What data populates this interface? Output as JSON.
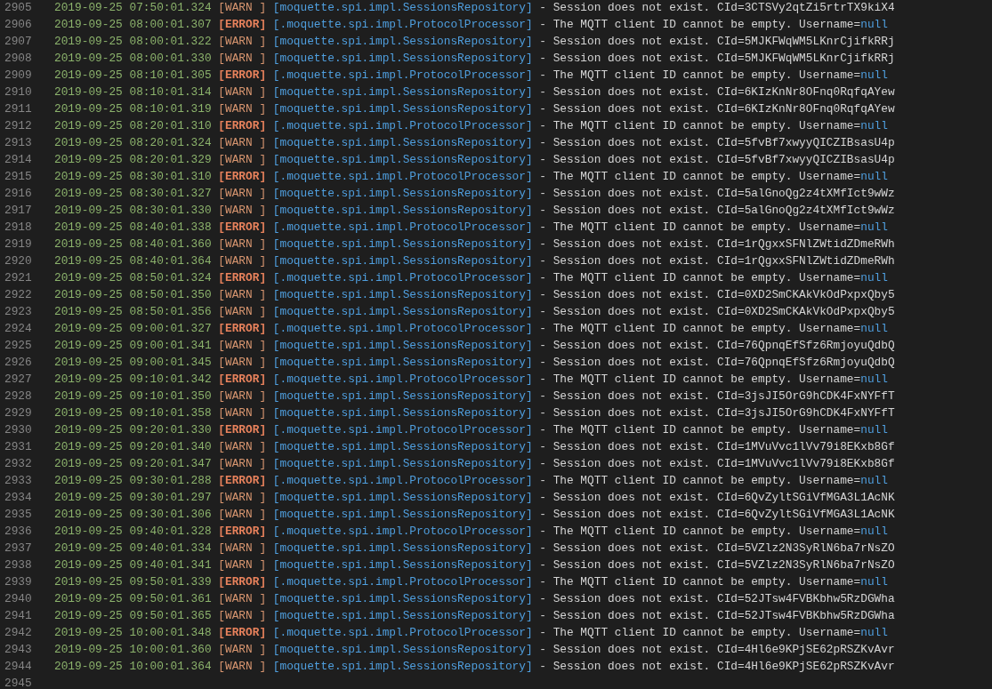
{
  "log_lines": [
    {
      "number": "2905",
      "kind": "warn",
      "timestamp": "2019-09-25 07:50:01.324",
      "level": "[WARN ]",
      "source": "[moquette.spi.impl.SessionsRepository]",
      "message": "- Session does not exist. CId=3CTSVy2qtZi5rtrTX9kiX4"
    },
    {
      "number": "2906",
      "kind": "error",
      "timestamp": "2019-09-25 08:00:01.307",
      "level": "[ERROR]",
      "source": "[.moquette.spi.impl.ProtocolProcessor]",
      "message": "- The MQTT client ID cannot be empty. Username=",
      "value": "null"
    },
    {
      "number": "2907",
      "kind": "warn",
      "timestamp": "2019-09-25 08:00:01.322",
      "level": "[WARN ]",
      "source": "[moquette.spi.impl.SessionsRepository]",
      "message": "- Session does not exist. CId=5MJKFWqWM5LKnrCjifkRRj"
    },
    {
      "number": "2908",
      "kind": "warn",
      "timestamp": "2019-09-25 08:00:01.330",
      "level": "[WARN ]",
      "source": "[moquette.spi.impl.SessionsRepository]",
      "message": "- Session does not exist. CId=5MJKFWqWM5LKnrCjifkRRj"
    },
    {
      "number": "2909",
      "kind": "error",
      "timestamp": "2019-09-25 08:10:01.305",
      "level": "[ERROR]",
      "source": "[.moquette.spi.impl.ProtocolProcessor]",
      "message": "- The MQTT client ID cannot be empty. Username=",
      "value": "null"
    },
    {
      "number": "2910",
      "kind": "warn",
      "timestamp": "2019-09-25 08:10:01.314",
      "level": "[WARN ]",
      "source": "[moquette.spi.impl.SessionsRepository]",
      "message": "- Session does not exist. CId=6KIzKnNr8OFnq0RqfqAYew"
    },
    {
      "number": "2911",
      "kind": "warn",
      "timestamp": "2019-09-25 08:10:01.319",
      "level": "[WARN ]",
      "source": "[moquette.spi.impl.SessionsRepository]",
      "message": "- Session does not exist. CId=6KIzKnNr8OFnq0RqfqAYew"
    },
    {
      "number": "2912",
      "kind": "error",
      "timestamp": "2019-09-25 08:20:01.310",
      "level": "[ERROR]",
      "source": "[.moquette.spi.impl.ProtocolProcessor]",
      "message": "- The MQTT client ID cannot be empty. Username=",
      "value": "null"
    },
    {
      "number": "2913",
      "kind": "warn",
      "timestamp": "2019-09-25 08:20:01.324",
      "level": "[WARN ]",
      "source": "[moquette.spi.impl.SessionsRepository]",
      "message": "- Session does not exist. CId=5fvBf7xwyyQICZIBsasU4p"
    },
    {
      "number": "2914",
      "kind": "warn",
      "timestamp": "2019-09-25 08:20:01.329",
      "level": "[WARN ]",
      "source": "[moquette.spi.impl.SessionsRepository]",
      "message": "- Session does not exist. CId=5fvBf7xwyyQICZIBsasU4p"
    },
    {
      "number": "2915",
      "kind": "error",
      "timestamp": "2019-09-25 08:30:01.310",
      "level": "[ERROR]",
      "source": "[.moquette.spi.impl.ProtocolProcessor]",
      "message": "- The MQTT client ID cannot be empty. Username=",
      "value": "null"
    },
    {
      "number": "2916",
      "kind": "warn",
      "timestamp": "2019-09-25 08:30:01.327",
      "level": "[WARN ]",
      "source": "[moquette.spi.impl.SessionsRepository]",
      "message": "- Session does not exist. CId=5alGnoQg2z4tXMfIct9wWz"
    },
    {
      "number": "2917",
      "kind": "warn",
      "timestamp": "2019-09-25 08:30:01.330",
      "level": "[WARN ]",
      "source": "[moquette.spi.impl.SessionsRepository]",
      "message": "- Session does not exist. CId=5alGnoQg2z4tXMfIct9wWz"
    },
    {
      "number": "2918",
      "kind": "error",
      "timestamp": "2019-09-25 08:40:01.338",
      "level": "[ERROR]",
      "source": "[.moquette.spi.impl.ProtocolProcessor]",
      "message": "- The MQTT client ID cannot be empty. Username=",
      "value": "null"
    },
    {
      "number": "2919",
      "kind": "warn",
      "timestamp": "2019-09-25 08:40:01.360",
      "level": "[WARN ]",
      "source": "[moquette.spi.impl.SessionsRepository]",
      "message": "- Session does not exist. CId=1rQgxxSFNlZWtidZDmeRWh"
    },
    {
      "number": "2920",
      "kind": "warn",
      "timestamp": "2019-09-25 08:40:01.364",
      "level": "[WARN ]",
      "source": "[moquette.spi.impl.SessionsRepository]",
      "message": "- Session does not exist. CId=1rQgxxSFNlZWtidZDmeRWh"
    },
    {
      "number": "2921",
      "kind": "error",
      "timestamp": "2019-09-25 08:50:01.324",
      "level": "[ERROR]",
      "source": "[.moquette.spi.impl.ProtocolProcessor]",
      "message": "- The MQTT client ID cannot be empty. Username=",
      "value": "null"
    },
    {
      "number": "2922",
      "kind": "warn",
      "timestamp": "2019-09-25 08:50:01.350",
      "level": "[WARN ]",
      "source": "[moquette.spi.impl.SessionsRepository]",
      "message": "- Session does not exist. CId=0XD2SmCKAkVkOdPxpxQby5"
    },
    {
      "number": "2923",
      "kind": "warn",
      "timestamp": "2019-09-25 08:50:01.356",
      "level": "[WARN ]",
      "source": "[moquette.spi.impl.SessionsRepository]",
      "message": "- Session does not exist. CId=0XD2SmCKAkVkOdPxpxQby5"
    },
    {
      "number": "2924",
      "kind": "error",
      "timestamp": "2019-09-25 09:00:01.327",
      "level": "[ERROR]",
      "source": "[.moquette.spi.impl.ProtocolProcessor]",
      "message": "- The MQTT client ID cannot be empty. Username=",
      "value": "null"
    },
    {
      "number": "2925",
      "kind": "warn",
      "timestamp": "2019-09-25 09:00:01.341",
      "level": "[WARN ]",
      "source": "[moquette.spi.impl.SessionsRepository]",
      "message": "- Session does not exist. CId=76QpnqEfSfz6RmjoyuQdbQ"
    },
    {
      "number": "2926",
      "kind": "warn",
      "timestamp": "2019-09-25 09:00:01.345",
      "level": "[WARN ]",
      "source": "[moquette.spi.impl.SessionsRepository]",
      "message": "- Session does not exist. CId=76QpnqEfSfz6RmjoyuQdbQ"
    },
    {
      "number": "2927",
      "kind": "error",
      "timestamp": "2019-09-25 09:10:01.342",
      "level": "[ERROR]",
      "source": "[.moquette.spi.impl.ProtocolProcessor]",
      "message": "- The MQTT client ID cannot be empty. Username=",
      "value": "null"
    },
    {
      "number": "2928",
      "kind": "warn",
      "timestamp": "2019-09-25 09:10:01.350",
      "level": "[WARN ]",
      "source": "[moquette.spi.impl.SessionsRepository]",
      "message": "- Session does not exist. CId=3jsJI5OrG9hCDK4FxNYFfT"
    },
    {
      "number": "2929",
      "kind": "warn",
      "timestamp": "2019-09-25 09:10:01.358",
      "level": "[WARN ]",
      "source": "[moquette.spi.impl.SessionsRepository]",
      "message": "- Session does not exist. CId=3jsJI5OrG9hCDK4FxNYFfT"
    },
    {
      "number": "2930",
      "kind": "error",
      "timestamp": "2019-09-25 09:20:01.330",
      "level": "[ERROR]",
      "source": "[.moquette.spi.impl.ProtocolProcessor]",
      "message": "- The MQTT client ID cannot be empty. Username=",
      "value": "null"
    },
    {
      "number": "2931",
      "kind": "warn",
      "timestamp": "2019-09-25 09:20:01.340",
      "level": "[WARN ]",
      "source": "[moquette.spi.impl.SessionsRepository]",
      "message": "- Session does not exist. CId=1MVuVvc1lVv79i8EKxb8Gf"
    },
    {
      "number": "2932",
      "kind": "warn",
      "timestamp": "2019-09-25 09:20:01.347",
      "level": "[WARN ]",
      "source": "[moquette.spi.impl.SessionsRepository]",
      "message": "- Session does not exist. CId=1MVuVvc1lVv79i8EKxb8Gf"
    },
    {
      "number": "2933",
      "kind": "error",
      "timestamp": "2019-09-25 09:30:01.288",
      "level": "[ERROR]",
      "source": "[.moquette.spi.impl.ProtocolProcessor]",
      "message": "- The MQTT client ID cannot be empty. Username=",
      "value": "null"
    },
    {
      "number": "2934",
      "kind": "warn",
      "timestamp": "2019-09-25 09:30:01.297",
      "level": "[WARN ]",
      "source": "[moquette.spi.impl.SessionsRepository]",
      "message": "- Session does not exist. CId=6QvZyltSGiVfMGA3L1AcNK"
    },
    {
      "number": "2935",
      "kind": "warn",
      "timestamp": "2019-09-25 09:30:01.306",
      "level": "[WARN ]",
      "source": "[moquette.spi.impl.SessionsRepository]",
      "message": "- Session does not exist. CId=6QvZyltSGiVfMGA3L1AcNK"
    },
    {
      "number": "2936",
      "kind": "error",
      "timestamp": "2019-09-25 09:40:01.328",
      "level": "[ERROR]",
      "source": "[.moquette.spi.impl.ProtocolProcessor]",
      "message": "- The MQTT client ID cannot be empty. Username=",
      "value": "null"
    },
    {
      "number": "2937",
      "kind": "warn",
      "timestamp": "2019-09-25 09:40:01.334",
      "level": "[WARN ]",
      "source": "[moquette.spi.impl.SessionsRepository]",
      "message": "- Session does not exist. CId=5VZlz2N3SyRlN6ba7rNsZO"
    },
    {
      "number": "2938",
      "kind": "warn",
      "timestamp": "2019-09-25 09:40:01.341",
      "level": "[WARN ]",
      "source": "[moquette.spi.impl.SessionsRepository]",
      "message": "- Session does not exist. CId=5VZlz2N3SyRlN6ba7rNsZO"
    },
    {
      "number": "2939",
      "kind": "error",
      "timestamp": "2019-09-25 09:50:01.339",
      "level": "[ERROR]",
      "source": "[.moquette.spi.impl.ProtocolProcessor]",
      "message": "- The MQTT client ID cannot be empty. Username=",
      "value": "null"
    },
    {
      "number": "2940",
      "kind": "warn",
      "timestamp": "2019-09-25 09:50:01.361",
      "level": "[WARN ]",
      "source": "[moquette.spi.impl.SessionsRepository]",
      "message": "- Session does not exist. CId=52JTsw4FVBKbhw5RzDGWha"
    },
    {
      "number": "2941",
      "kind": "warn",
      "timestamp": "2019-09-25 09:50:01.365",
      "level": "[WARN ]",
      "source": "[moquette.spi.impl.SessionsRepository]",
      "message": "- Session does not exist. CId=52JTsw4FVBKbhw5RzDGWha"
    },
    {
      "number": "2942",
      "kind": "error",
      "timestamp": "2019-09-25 10:00:01.348",
      "level": "[ERROR]",
      "source": "[.moquette.spi.impl.ProtocolProcessor]",
      "message": "- The MQTT client ID cannot be empty. Username=",
      "value": "null"
    },
    {
      "number": "2943",
      "kind": "warn",
      "timestamp": "2019-09-25 10:00:01.360",
      "level": "[WARN ]",
      "source": "[moquette.spi.impl.SessionsRepository]",
      "message": "- Session does not exist. CId=4Hl6e9KPjSE62pRSZKvAvr"
    },
    {
      "number": "2944",
      "kind": "warn",
      "timestamp": "2019-09-25 10:00:01.364",
      "level": "[WARN ]",
      "source": "[moquette.spi.impl.SessionsRepository]",
      "message": "- Session does not exist. CId=4Hl6e9KPjSE62pRSZKvAvr"
    },
    {
      "number": "2945",
      "kind": "blank"
    }
  ]
}
